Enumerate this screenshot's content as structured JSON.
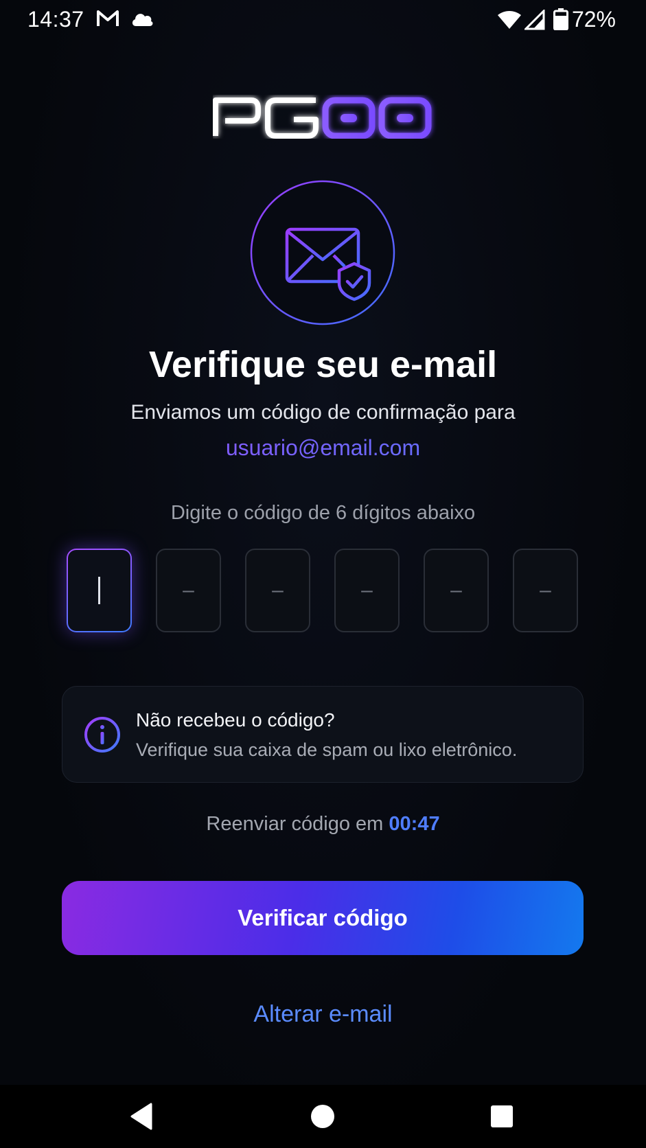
{
  "status_bar": {
    "time": "14:37",
    "battery": "72%",
    "icons": [
      "gmail-icon",
      "cloud-icon",
      "wifi-icon",
      "signal-icon",
      "battery-icon"
    ]
  },
  "brand": {
    "logo": "PGOO"
  },
  "colors": {
    "accent_purple": "#8a2be2",
    "accent_blue": "#1479ee",
    "link_blue": "#5b8cff",
    "background": "#05070c"
  },
  "header": {
    "title": "Verifique seu e-mail",
    "subtitle": "Enviamos um código de confirmação para",
    "email": "usuario@email.com"
  },
  "code": {
    "hint": "Digite o código de 6 dígitos abaixo",
    "placeholder": "–"
  },
  "info": {
    "title": "Não recebeu o código?",
    "text": "Verifique sua caixa de spam ou lixo eletrônico."
  },
  "resend": {
    "label": "Reenviar código em",
    "timer": "00:47"
  },
  "actions": {
    "verify_label": "Verificar código",
    "change_email_label": "Alterar e-mail"
  }
}
